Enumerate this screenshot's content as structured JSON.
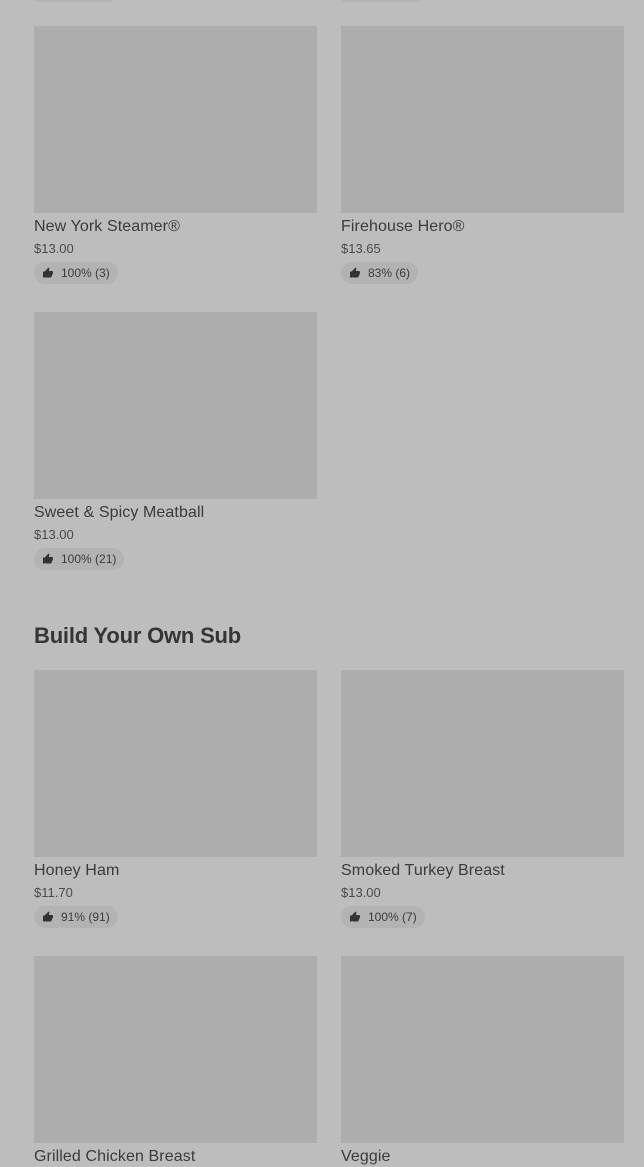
{
  "top_group": {
    "items": [
      {
        "name": "New York Steamer®",
        "price": "$13.00",
        "rating": "100% (3)"
      },
      {
        "name": "Firehouse Hero®",
        "price": "$13.65",
        "rating": "83% (6)"
      },
      {
        "name": "Sweet & Spicy Meatball",
        "price": "$13.00",
        "rating": "100% (21)"
      }
    ]
  },
  "build_section": {
    "title": "Build Your Own Sub",
    "items": [
      {
        "name": "Honey Ham",
        "price": "$11.70",
        "rating": "91% (91)"
      },
      {
        "name": "Smoked Turkey Breast",
        "price": "$13.00",
        "rating": "100% (7)"
      },
      {
        "name": "Grilled Chicken Breast"
      },
      {
        "name": "Veggie"
      }
    ]
  },
  "icons": {
    "rating_icon": "thumbs-up-icon"
  },
  "colors": {
    "background": "#bdbdbd",
    "thumbnail_placeholder": "#adadad",
    "rating_pill": "#b3b3b3",
    "text": "#3a3a3a"
  }
}
